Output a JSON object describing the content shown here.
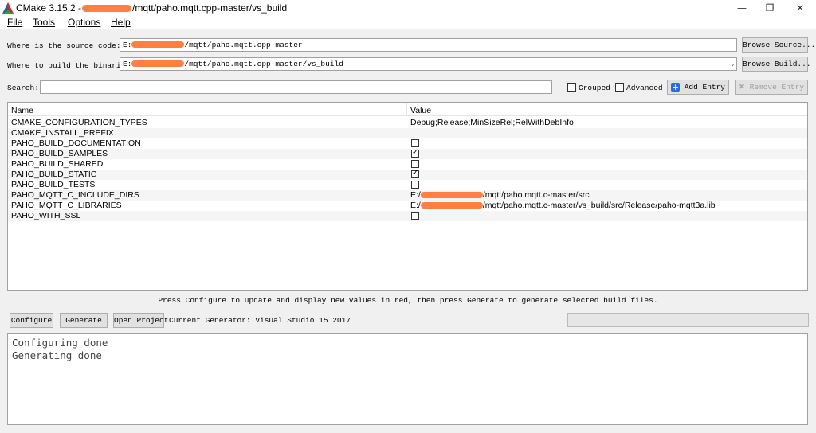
{
  "window": {
    "title_prefix": "CMake 3.15.2 -",
    "title_suffix": "/mqtt/paho.mqtt.cpp-master/vs_build",
    "minimize": "—",
    "restore": "❐",
    "close": "✕"
  },
  "menu": [
    "File",
    "Tools",
    "Options",
    "Help"
  ],
  "source": {
    "label": "Where is the source code:",
    "drive": "E:",
    "path": "/mqtt/paho.mqtt.cpp-master",
    "browse_label": "Browse Source..."
  },
  "build": {
    "label": "Where to build the binaries:",
    "drive": "E:",
    "path": "/mqtt/paho.mqtt.cpp-master/vs_build",
    "browse_label": "Browse Build..."
  },
  "search": {
    "label": "Search:",
    "value": "",
    "grouped_label": "Grouped",
    "grouped_checked": false,
    "advanced_label": "Advanced",
    "advanced_checked": false,
    "add_entry_label": "Add Entry",
    "remove_entry_label": "Remove Entry"
  },
  "table": {
    "columns": [
      "Name",
      "Value"
    ],
    "rows": [
      {
        "name": "CMAKE_CONFIGURATION_TYPES",
        "value": "Debug;Release;MinSizeRel;RelWithDebInfo"
      },
      {
        "name": "CMAKE_INSTALL_PREFIX",
        "value": ""
      },
      {
        "name": "PAHO_BUILD_DOCUMENTATION",
        "checkbox": true,
        "checked": false
      },
      {
        "name": "PAHO_BUILD_SAMPLES",
        "checkbox": true,
        "checked": true
      },
      {
        "name": "PAHO_BUILD_SHARED",
        "checkbox": true,
        "checked": false
      },
      {
        "name": "PAHO_BUILD_STATIC",
        "checkbox": true,
        "checked": true
      },
      {
        "name": "PAHO_BUILD_TESTS",
        "checkbox": true,
        "checked": false
      },
      {
        "name": "PAHO_MQTT_C_INCLUDE_DIRS",
        "drive": "E:/",
        "value": "/mqtt/paho.mqtt.c-master/src"
      },
      {
        "name": "PAHO_MQTT_C_LIBRARIES",
        "drive": "E:/",
        "value": "/mqtt/paho.mqtt.c-master/vs_build/src/Release/paho-mqtt3a.lib"
      },
      {
        "name": "PAHO_WITH_SSL",
        "checkbox": true,
        "checked": false
      }
    ]
  },
  "hint": "Press Configure to update and display new values in red, then press Generate to generate selected build files.",
  "actions": {
    "configure_label": "Configure",
    "generate_label": "Generate",
    "open_project_label": "Open Project",
    "generator_text": "Current Generator: Visual Studio 15 2017"
  },
  "output": [
    "Configuring done",
    "Generating done"
  ],
  "colors": {
    "redaction": "#ff8040",
    "window_bg": "#f0f0f0"
  },
  "icons": {
    "app": "cmake-logo-icon",
    "add": "plus-icon",
    "remove": "cross-icon",
    "dropdown": "chevron-down-icon"
  }
}
